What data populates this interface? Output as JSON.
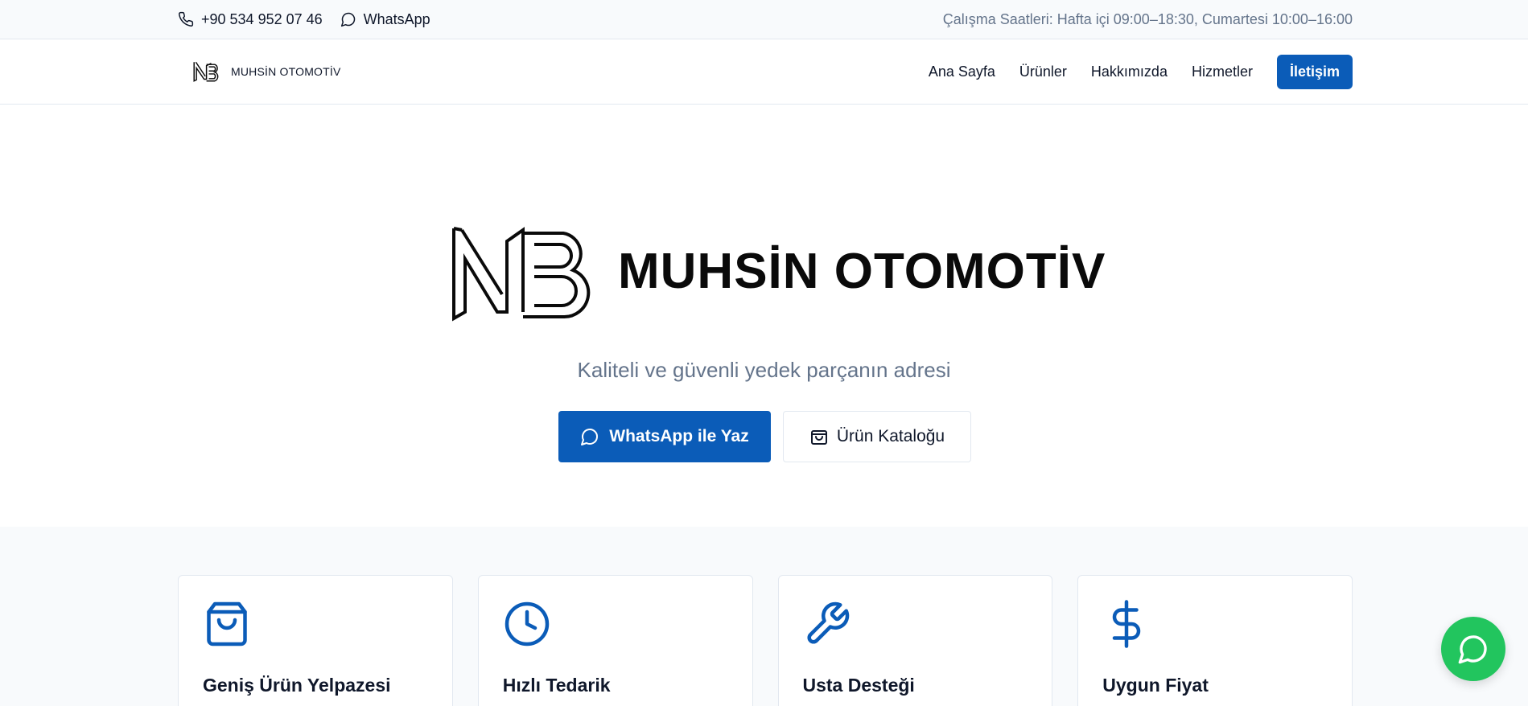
{
  "topbar": {
    "phone": "+90 534 952 07 46",
    "whatsapp": "WhatsApp",
    "hours": "Çalışma Saatleri: Hafta içi 09:00–18:30, Cumartesi 10:00–16:00"
  },
  "header": {
    "brand": "MUHSİN OTOMOTİV",
    "nav": [
      "Ana Sayfa",
      "Ürünler",
      "Hakkımızda",
      "Hizmetler"
    ],
    "cta": "İletişim"
  },
  "hero": {
    "brand": "MUHSİN OTOMOTİV",
    "tagline": "Kaliteli ve güvenli yedek parçanın adresi",
    "primary_button": "WhatsApp ile Yaz",
    "secondary_button": "Ürün Kataloğu"
  },
  "features": [
    {
      "title": "Geniş Ürün Yelpazesi",
      "icon": "shopping-bag-icon"
    },
    {
      "title": "Hızlı Tedarik",
      "icon": "clock-icon"
    },
    {
      "title": "Usta Desteği",
      "icon": "wrench-icon"
    },
    {
      "title": "Uygun Fiyat",
      "icon": "dollar-icon"
    }
  ],
  "colors": {
    "accent": "#0b5cb8",
    "whatsapp_green": "#22c55e",
    "muted_text": "#64748b"
  }
}
